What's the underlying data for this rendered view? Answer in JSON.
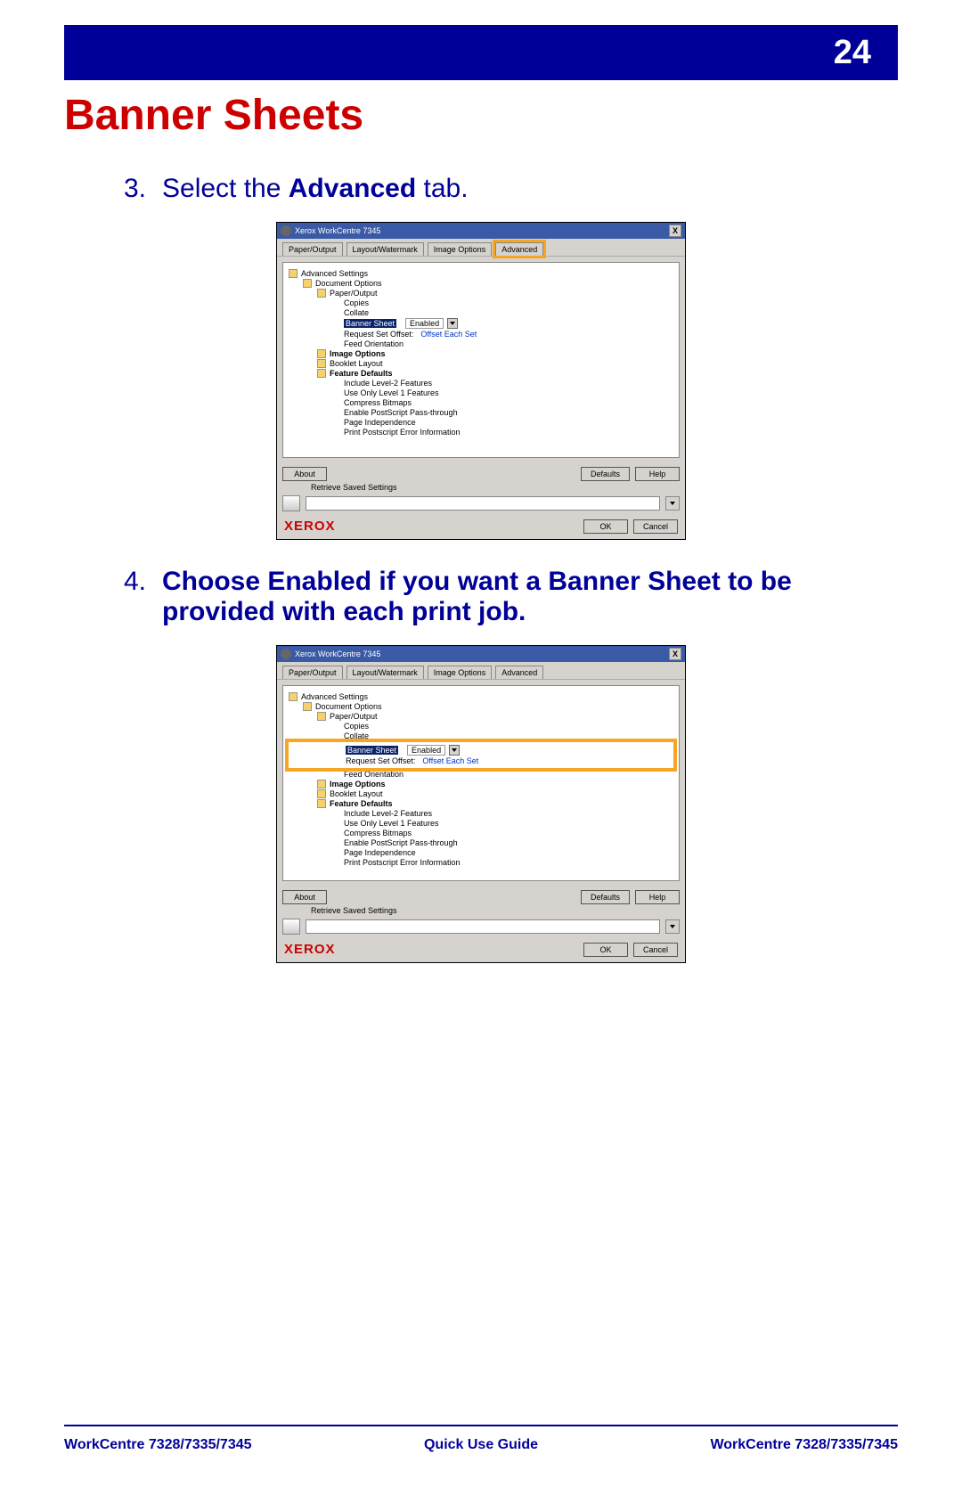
{
  "page_number": "24",
  "title": "Banner Sheets",
  "steps": [
    {
      "num": "3.",
      "prefix": "Select the ",
      "bold": "Advanced",
      "suffix": " tab."
    },
    {
      "num": "4.",
      "text": "Choose Enabled if you want a Banner Sheet to be provided with each print job."
    }
  ],
  "dialog": {
    "window_title": "Xerox WorkCentre 7345",
    "close_glyph": "X",
    "tabs": [
      "Paper/Output",
      "Layout/Watermark",
      "Image Options",
      "Advanced"
    ],
    "tree": {
      "root": "Advanced Settings",
      "doc_options": "Document Options",
      "paper_output": "Paper/Output",
      "items_upper": [
        "Copies",
        "Collate"
      ],
      "banner_label": "Banner Sheet",
      "banner_value": "Enabled",
      "request_offset_label": "Request Set Offset:",
      "request_offset_value": "Offset Each Set",
      "feed_orientation": "Feed Orientation",
      "image_options": "Image Options",
      "booklet": "Booklet Layout",
      "feature_defaults": "Feature Defaults",
      "items_lower": [
        "Include Level-2 Features",
        "Use Only Level 1 Features",
        "Compress Bitmaps",
        "Enable PostScript Pass-through",
        "Page Independence",
        "Print Postscript Error Information"
      ]
    },
    "buttons": {
      "about": "About",
      "defaults": "Defaults",
      "help": "Help",
      "ok": "OK",
      "cancel": "Cancel"
    },
    "retrieve_label": "Retrieve Saved Settings",
    "brand": "XEROX"
  },
  "footer": {
    "left": "WorkCentre 7328/7335/7345",
    "center": "Quick Use Guide",
    "right": "WorkCentre 7328/7335/7345"
  }
}
